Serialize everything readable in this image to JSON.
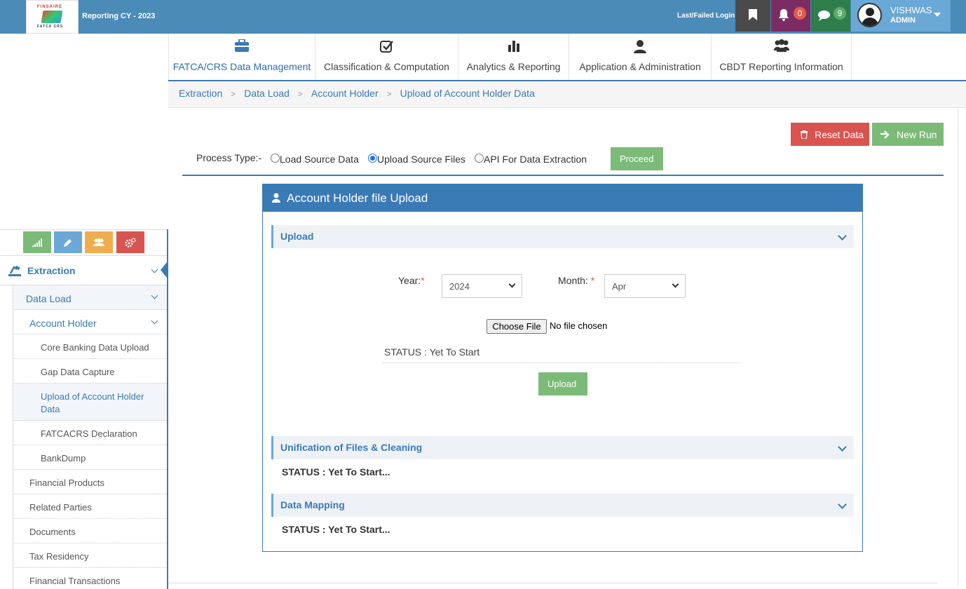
{
  "header": {
    "reporting_label": "Reporting CY - 2023",
    "last_login_label": "Last/Failed Login:",
    "notifications_count": "0",
    "messages_count": "9",
    "user_name": "VISHWAS",
    "user_role": "ADMIN",
    "logo_top_text": "FINSAIRE",
    "logo_bottom_text": "FATCA CRS"
  },
  "nav": {
    "tabs": [
      {
        "label": "FATCA/CRS Data Management",
        "icon": "briefcase-icon",
        "active": true
      },
      {
        "label": "Classification & Computation",
        "icon": "check-square-icon"
      },
      {
        "label": "Analytics & Reporting",
        "icon": "bar-chart-icon"
      },
      {
        "label": "Application & Administration",
        "icon": "user-icon"
      },
      {
        "label": "CBDT Reporting Information",
        "icon": "users-icon"
      }
    ]
  },
  "breadcrumb": [
    "Extraction",
    "Data Load",
    "Account Holder",
    "Upload of Account Holder Data"
  ],
  "actions": {
    "reset_label": "Reset Data",
    "new_run_label": "New Run"
  },
  "process": {
    "label": "Process Type:-",
    "options": [
      "Load Source Data",
      "Upload Source Files",
      "API For Data Extraction"
    ],
    "selected": "Upload Source Files",
    "proceed_label": "Proceed"
  },
  "panel": {
    "title": "Account Holder file Upload",
    "upload_section": "Upload",
    "year_label": "Year:",
    "year_value": "2024",
    "month_label": "Month: ",
    "month_value": "Apr",
    "required_mark": "*",
    "choose_file_label": "Choose File",
    "no_file_label": "No file chosen",
    "upload_status": "STATUS : Yet To Start",
    "upload_button": "Upload",
    "unification_section": "Unification of Files & Cleaning",
    "unification_status": "STATUS : Yet To Start...",
    "mapping_section": "Data Mapping",
    "mapping_status": "STATUS : Yet To Start..."
  },
  "sidebar": {
    "toolbar_icons": [
      "signal-icon",
      "pencil-icon",
      "users-icon",
      "gears-icon"
    ],
    "extraction_label": "Extraction",
    "data_load_label": "Data Load",
    "account_holder_label": "Account Holder",
    "account_holder_items": [
      "Core Banking Data Upload",
      "Gap Data Capture",
      "Upload of Account Holder Data",
      "FATCACRS Declaration",
      "BankDump"
    ],
    "other_items": [
      "Financial Products",
      "Related Parties",
      "Documents",
      "Tax Residency",
      "Financial Transactions"
    ]
  },
  "colors": {
    "primary": "#3a7ab5",
    "success": "#7cba78",
    "danger": "#d9534f",
    "topbar": "#4a8bb8"
  }
}
